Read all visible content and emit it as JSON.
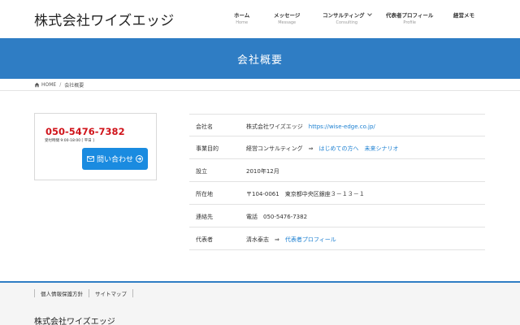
{
  "header": {
    "logo": "株式会社ワイズエッジ",
    "nav": [
      {
        "label": "ホーム",
        "sub": "Home"
      },
      {
        "label": "メッセージ",
        "sub": "Message"
      },
      {
        "label": "コンサルティング",
        "sub": "Consulting"
      },
      {
        "label": "代表者プロフィール",
        "sub": "Profile"
      },
      {
        "label": "経営メモ",
        "sub": ""
      }
    ]
  },
  "page": {
    "title": "会社概要"
  },
  "breadcrumb": {
    "home": "HOME",
    "separator": "/",
    "current": "会社概要"
  },
  "contact": {
    "phone": "050-5476-7382",
    "hours": "受付時間 9:00-18:00 [ 平日 ]",
    "button_label": "問い合わせ"
  },
  "info": {
    "rows": [
      {
        "label": "会社名",
        "value": "株式会社ワイズエッジ",
        "link": "https://wise-edge.co.jp/"
      },
      {
        "label": "事業目的",
        "value": "経営コンサルティング　⇒",
        "link": "はじめての方へ",
        "link2": "未来シナリオ"
      },
      {
        "label": "設立",
        "value": "2010年12月"
      },
      {
        "label": "所在地",
        "value": "〒104-0061　東京都中央区銀座３－１３－１"
      },
      {
        "label": "連絡先",
        "value": "電話　050-5476-7382"
      },
      {
        "label": "代表者",
        "value": "清水泰志　⇒",
        "link": "代表者プロフィール"
      }
    ]
  },
  "footer": {
    "links": [
      "個人情報保護方針",
      "サイトマップ"
    ],
    "company": "株式会社ワイズエッジ"
  },
  "colors": {
    "accent": "#2f7dc4",
    "button": "#1a8be0",
    "phone": "#d0141b",
    "link": "#1b7fd1"
  }
}
